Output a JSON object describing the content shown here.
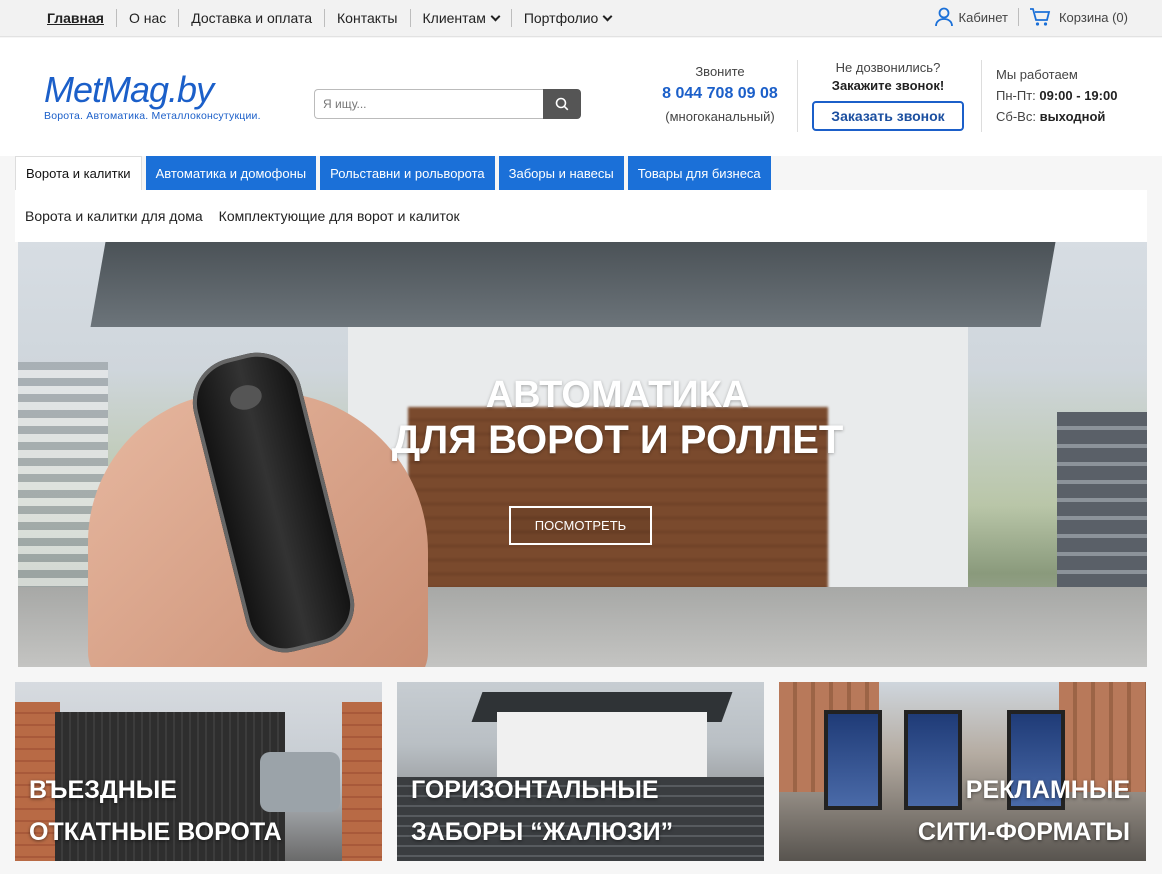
{
  "topnav": {
    "items": [
      {
        "label": "Главная"
      },
      {
        "label": "О нас"
      },
      {
        "label": "Доставка и оплата"
      },
      {
        "label": "Контакты"
      },
      {
        "label": "Клиентам",
        "dropdown": true
      },
      {
        "label": "Портфолио",
        "dropdown": true
      }
    ],
    "cabinet": "Кабинет",
    "cart": "Корзина (0)"
  },
  "logo": {
    "name": "MetMag.by",
    "tagline": "Ворота. Автоматика. Металлоконсутукции."
  },
  "search": {
    "placeholder": "Я ищу..."
  },
  "contact": {
    "label": "Звоните",
    "phone": "8 044 708 09 08",
    "note": "(многоканальный)"
  },
  "callback": {
    "line1": "Не дозвонились?",
    "line2": "Закажите звонок!",
    "button": "Заказать звонок"
  },
  "hours": {
    "title": "Мы работаем",
    "weekdays_label": "Пн-Пт:",
    "weekdays_value": "09:00 - 19:00",
    "weekend_label": "Сб-Вс:",
    "weekend_value": "выходной"
  },
  "category_tabs": [
    {
      "label": "Ворота и калитки",
      "active": true
    },
    {
      "label": "Автоматика и домофоны"
    },
    {
      "label": "Рольставни и рольворота"
    },
    {
      "label": "Заборы и навесы"
    },
    {
      "label": "Товары для бизнеса"
    }
  ],
  "subnav": [
    {
      "label": "Ворота и калитки для дома"
    },
    {
      "label": "Комплектующие для ворот и калиток"
    }
  ],
  "hero": {
    "title_line1": "АВТОМАТИКА",
    "title_line2": "ДЛЯ ВОРОТ И РОЛЛЕТ",
    "button": "ПОСМОТРЕТЬ"
  },
  "cards": [
    {
      "line1": "ВЪЕЗДНЫЕ",
      "line2": "ОТКАТНЫЕ ВОРОТА"
    },
    {
      "line1": "ГОРИЗОНТАЛЬНЫЕ",
      "line2": "ЗАБОРЫ “ЖАЛЮЗИ”"
    },
    {
      "line1": "РЕКЛАМНЫЕ",
      "line2": "СИТИ-ФОРМАТЫ"
    }
  ],
  "colors": {
    "brand_blue": "#1b5fc9",
    "tab_blue": "#1b70d8"
  }
}
